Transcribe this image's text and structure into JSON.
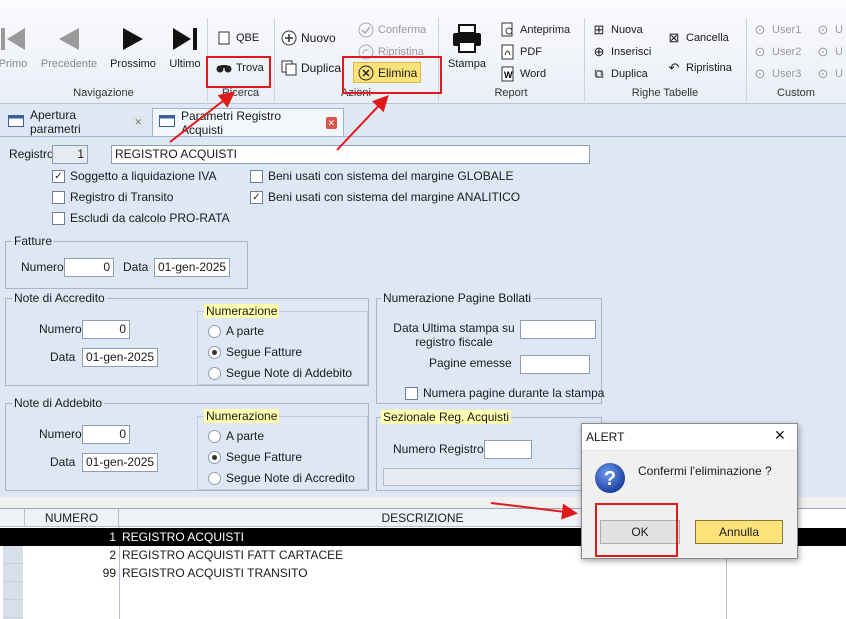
{
  "ribbon": {
    "nav": {
      "first": "Primo",
      "prev": "Precedente",
      "next": "Prossimo",
      "last": "Ultimo",
      "group": "Navigazione"
    },
    "search": {
      "qbe": "QBE",
      "find": "Trova",
      "group": "Ricerca"
    },
    "actions": {
      "new": "Nuovo",
      "duplicate": "Duplica",
      "confirm": "Conferma",
      "restore": "Ripristina",
      "delete": "Elimina",
      "group": "Azioni"
    },
    "report": {
      "print": "Stampa",
      "preview": "Anteprima",
      "pdf": "PDF",
      "word": "Word",
      "group": "Report"
    },
    "rows": {
      "new": "Nuova",
      "insert": "Inserisci",
      "duplicate": "Duplica",
      "delete": "Cancella",
      "restore": "Ripristina",
      "group": "Righe Tabelle"
    },
    "custom": {
      "user1": "User1",
      "user2": "User2",
      "user3": "User3",
      "u": "U",
      "group": "Custom"
    }
  },
  "tabs": [
    {
      "label": "Apertura parametri"
    },
    {
      "label": "Parametri Registro Acquisti"
    }
  ],
  "form": {
    "registro_label": "Registro",
    "registro_num": "1",
    "registro_desc": "REGISTRO ACQUISTI",
    "chk_iva": "Soggetto a liquidazione IVA",
    "chk_transito": "Registro di Transito",
    "chk_prorata": "Escludi da calcolo PRO-RATA",
    "chk_globale": "Beni usati con sistema del margine GLOBALE",
    "chk_analitico": "Beni usati con sistema del margine ANALITICO",
    "fatture": {
      "legend": "Fatture",
      "numero_label": "Numero",
      "numero": "0",
      "data_label": "Data",
      "data": "01-gen-2025"
    },
    "credito": {
      "legend": "Note di Accredito",
      "numero_label": "Numero",
      "numero": "0",
      "data_label": "Data",
      "data": "01-gen-2025",
      "num_legend": "Numerazione",
      "opt1": "A parte",
      "opt2": "Segue Fatture",
      "opt3": "Segue Note di Addebito"
    },
    "addebito": {
      "legend": "Note di Addebito",
      "numero_label": "Numero",
      "numero": "0",
      "data_label": "Data",
      "data": "01-gen-2025",
      "num_legend": "Numerazione",
      "opt1": "A parte",
      "opt2": "Segue Fatture",
      "opt3": "Segue Note di Accredito"
    },
    "bollati": {
      "legend": "Numerazione Pagine Bollati",
      "data_label": "Data Ultima stampa su registro fiscale",
      "pagine_label": "Pagine emesse",
      "chk": "Numera pagine durante la stampa"
    },
    "sezionale": {
      "legend": "Sezionale Reg. Acquisti",
      "numero_label": "Numero Registro"
    }
  },
  "grid": {
    "col_numero": "NUMERO",
    "col_descrizione": "DESCRIZIONE",
    "rows": [
      {
        "numero": "1",
        "descrizione": "REGISTRO ACQUISTI"
      },
      {
        "numero": "2",
        "descrizione": "REGISTRO ACQUISTI FATT CARTACEE"
      },
      {
        "numero": "99",
        "descrizione": "REGISTRO ACQUISTI TRANSITO"
      }
    ]
  },
  "dialog": {
    "title": "ALERT",
    "message": "Confermi l'eliminazione ?",
    "ok": "OK",
    "cancel": "Annulla"
  },
  "colors": {
    "highlight_red": "#e01a1a",
    "form_bg": "#dee8f5",
    "legend_yellow": "#ffffb0",
    "delete_btn": "#fbe37a"
  }
}
